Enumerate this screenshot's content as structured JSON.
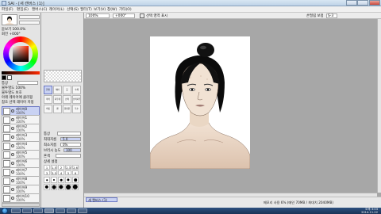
{
  "window": {
    "title": "SAI - [새 캔버스 (1)]"
  },
  "menu": [
    "파일(F)",
    "편집(E)",
    "캔버스(C)",
    "레이어(L)",
    "선택(S)",
    "필터(T)",
    "보기(V)",
    "창(W)",
    "기타(O)"
  ],
  "toolbar": {
    "zoom": "100%",
    "angle": "+000°",
    "stabilizer_label": "손떨림 보정",
    "stabilizer_value": "S-3",
    "antialias_label": "선택 영역 표시"
  },
  "left": {
    "zoom_label": "돋보기 100.0%",
    "angle_label": "회전 +000°",
    "mode_label": "통상",
    "opacity_label": "불투명도 100%",
    "protect_label": "불투명도 보호",
    "clip_label": "아래 레이어에 클리핑",
    "selection_label": "참조 선택 레이어 지정",
    "layers": [
      {
        "name": "레이어0",
        "mode": "통상",
        "opacity": "100%"
      },
      {
        "name": "레이어1",
        "mode": "통상",
        "opacity": "100%"
      },
      {
        "name": "레이어2",
        "mode": "통상",
        "opacity": "100%"
      },
      {
        "name": "레이어3",
        "mode": "통상",
        "opacity": "100%"
      },
      {
        "name": "레이어4",
        "mode": "통상",
        "opacity": "100%"
      },
      {
        "name": "레이어5",
        "mode": "통상",
        "opacity": "100%"
      },
      {
        "name": "레이어6",
        "mode": "통상",
        "opacity": "100%"
      },
      {
        "name": "레이어7",
        "mode": "통상",
        "opacity": "100%"
      },
      {
        "name": "레이어8",
        "mode": "통상",
        "opacity": "100%"
      },
      {
        "name": "레이어9",
        "mode": "통상",
        "opacity": "100%"
      },
      {
        "name": "레이어10",
        "mode": "통상",
        "opacity": "100%"
      }
    ]
  },
  "tools": {
    "items": [
      "연필",
      "에어",
      "붓",
      "수채",
      "마커",
      "지우개",
      "선택",
      "선택지우",
      "버킷",
      "펜",
      "물방울",
      "특수"
    ],
    "mode_label": "통상",
    "size_label": "최대지름",
    "size_value": "5.0",
    "min_size_label": "최소지름",
    "min_size_value": "0%",
    "density_label": "브러시 농도",
    "density_value": "100",
    "blending_label": "혼색",
    "detail_label": "상세 설정",
    "presets": [
      "1",
      "1.5",
      "2",
      "2.3",
      "2.6",
      "3",
      "3.5",
      "4",
      "5",
      "6"
    ]
  },
  "status": {
    "tab": "새 캔버스 (1)",
    "text": "메모리 사용 6% (메인 70MB / 최대치 2040MB)"
  },
  "taskbar": {
    "time": "오후 3:03",
    "date": "2014-11-22"
  },
  "colors": {
    "accent": "#6b78c4",
    "canvas_bg": "#a7a7a7"
  }
}
